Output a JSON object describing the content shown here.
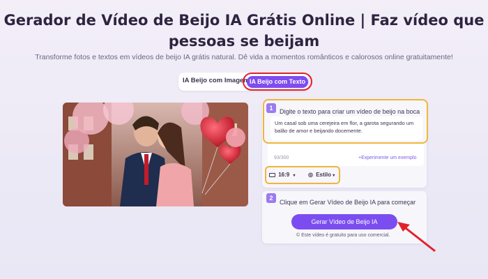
{
  "header": {
    "title": "Gerador de Vídeo de Beijo IA Grátis Online | Faz vídeo que pessoas se beijam",
    "subtitle": "Transforme fotos e textos em vídeos de beijo IA grátis natural. Dê vida a momentos românticos e calorosos online gratuitamente!"
  },
  "mode_tabs": [
    {
      "label": "IA Beijo com Imagem",
      "selected": false
    },
    {
      "label": "IA Beijo com Texto",
      "selected": true
    }
  ],
  "step1": {
    "number": "1",
    "label": "Digite o texto para criar um vídeo de beijo na boca",
    "prompt_text": "Um casal sob uma cerejeira em flor, a garota segurando um balão de amor e beijando docemente.",
    "char_count": "93/300",
    "example_link": "+Experimente um exemplo",
    "aspect_ratio": "16:9",
    "style_label": "Estilo"
  },
  "step2": {
    "number": "2",
    "label": "Clique em Gerar Vídeo de Beijo IA para começar",
    "button_label": "Gerar Vídeo de Beijo IA",
    "note": "Este vídeo é gratuito para uso comercial."
  },
  "colors": {
    "accent": "#7b4df0",
    "highlight_red": "#e3202a",
    "highlight_yellow": "#f0b63a"
  }
}
